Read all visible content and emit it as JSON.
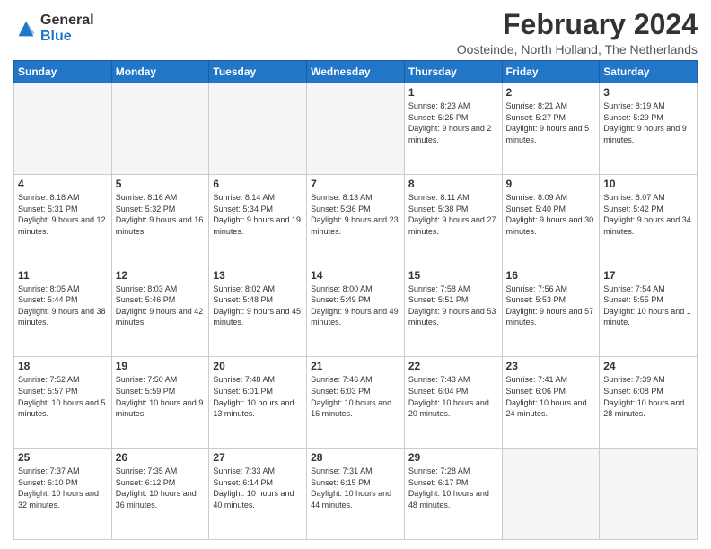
{
  "logo": {
    "general": "General",
    "blue": "Blue"
  },
  "title": "February 2024",
  "subtitle": "Oosteinde, North Holland, The Netherlands",
  "weekdays": [
    "Sunday",
    "Monday",
    "Tuesday",
    "Wednesday",
    "Thursday",
    "Friday",
    "Saturday"
  ],
  "weeks": [
    [
      {
        "day": "",
        "empty": true
      },
      {
        "day": "",
        "empty": true
      },
      {
        "day": "",
        "empty": true
      },
      {
        "day": "",
        "empty": true
      },
      {
        "day": "1",
        "sunrise": "8:23 AM",
        "sunset": "5:25 PM",
        "daylight": "9 hours and 2 minutes."
      },
      {
        "day": "2",
        "sunrise": "8:21 AM",
        "sunset": "5:27 PM",
        "daylight": "9 hours and 5 minutes."
      },
      {
        "day": "3",
        "sunrise": "8:19 AM",
        "sunset": "5:29 PM",
        "daylight": "9 hours and 9 minutes."
      }
    ],
    [
      {
        "day": "4",
        "sunrise": "8:18 AM",
        "sunset": "5:31 PM",
        "daylight": "9 hours and 12 minutes."
      },
      {
        "day": "5",
        "sunrise": "8:16 AM",
        "sunset": "5:32 PM",
        "daylight": "9 hours and 16 minutes."
      },
      {
        "day": "6",
        "sunrise": "8:14 AM",
        "sunset": "5:34 PM",
        "daylight": "9 hours and 19 minutes."
      },
      {
        "day": "7",
        "sunrise": "8:13 AM",
        "sunset": "5:36 PM",
        "daylight": "9 hours and 23 minutes."
      },
      {
        "day": "8",
        "sunrise": "8:11 AM",
        "sunset": "5:38 PM",
        "daylight": "9 hours and 27 minutes."
      },
      {
        "day": "9",
        "sunrise": "8:09 AM",
        "sunset": "5:40 PM",
        "daylight": "9 hours and 30 minutes."
      },
      {
        "day": "10",
        "sunrise": "8:07 AM",
        "sunset": "5:42 PM",
        "daylight": "9 hours and 34 minutes."
      }
    ],
    [
      {
        "day": "11",
        "sunrise": "8:05 AM",
        "sunset": "5:44 PM",
        "daylight": "9 hours and 38 minutes."
      },
      {
        "day": "12",
        "sunrise": "8:03 AM",
        "sunset": "5:46 PM",
        "daylight": "9 hours and 42 minutes."
      },
      {
        "day": "13",
        "sunrise": "8:02 AM",
        "sunset": "5:48 PM",
        "daylight": "9 hours and 45 minutes."
      },
      {
        "day": "14",
        "sunrise": "8:00 AM",
        "sunset": "5:49 PM",
        "daylight": "9 hours and 49 minutes."
      },
      {
        "day": "15",
        "sunrise": "7:58 AM",
        "sunset": "5:51 PM",
        "daylight": "9 hours and 53 minutes."
      },
      {
        "day": "16",
        "sunrise": "7:56 AM",
        "sunset": "5:53 PM",
        "daylight": "9 hours and 57 minutes."
      },
      {
        "day": "17",
        "sunrise": "7:54 AM",
        "sunset": "5:55 PM",
        "daylight": "10 hours and 1 minute."
      }
    ],
    [
      {
        "day": "18",
        "sunrise": "7:52 AM",
        "sunset": "5:57 PM",
        "daylight": "10 hours and 5 minutes."
      },
      {
        "day": "19",
        "sunrise": "7:50 AM",
        "sunset": "5:59 PM",
        "daylight": "10 hours and 9 minutes."
      },
      {
        "day": "20",
        "sunrise": "7:48 AM",
        "sunset": "6:01 PM",
        "daylight": "10 hours and 13 minutes."
      },
      {
        "day": "21",
        "sunrise": "7:46 AM",
        "sunset": "6:03 PM",
        "daylight": "10 hours and 16 minutes."
      },
      {
        "day": "22",
        "sunrise": "7:43 AM",
        "sunset": "6:04 PM",
        "daylight": "10 hours and 20 minutes."
      },
      {
        "day": "23",
        "sunrise": "7:41 AM",
        "sunset": "6:06 PM",
        "daylight": "10 hours and 24 minutes."
      },
      {
        "day": "24",
        "sunrise": "7:39 AM",
        "sunset": "6:08 PM",
        "daylight": "10 hours and 28 minutes."
      }
    ],
    [
      {
        "day": "25",
        "sunrise": "7:37 AM",
        "sunset": "6:10 PM",
        "daylight": "10 hours and 32 minutes."
      },
      {
        "day": "26",
        "sunrise": "7:35 AM",
        "sunset": "6:12 PM",
        "daylight": "10 hours and 36 minutes."
      },
      {
        "day": "27",
        "sunrise": "7:33 AM",
        "sunset": "6:14 PM",
        "daylight": "10 hours and 40 minutes."
      },
      {
        "day": "28",
        "sunrise": "7:31 AM",
        "sunset": "6:15 PM",
        "daylight": "10 hours and 44 minutes."
      },
      {
        "day": "29",
        "sunrise": "7:28 AM",
        "sunset": "6:17 PM",
        "daylight": "10 hours and 48 minutes."
      },
      {
        "day": "",
        "empty": true
      },
      {
        "day": "",
        "empty": true
      }
    ]
  ]
}
